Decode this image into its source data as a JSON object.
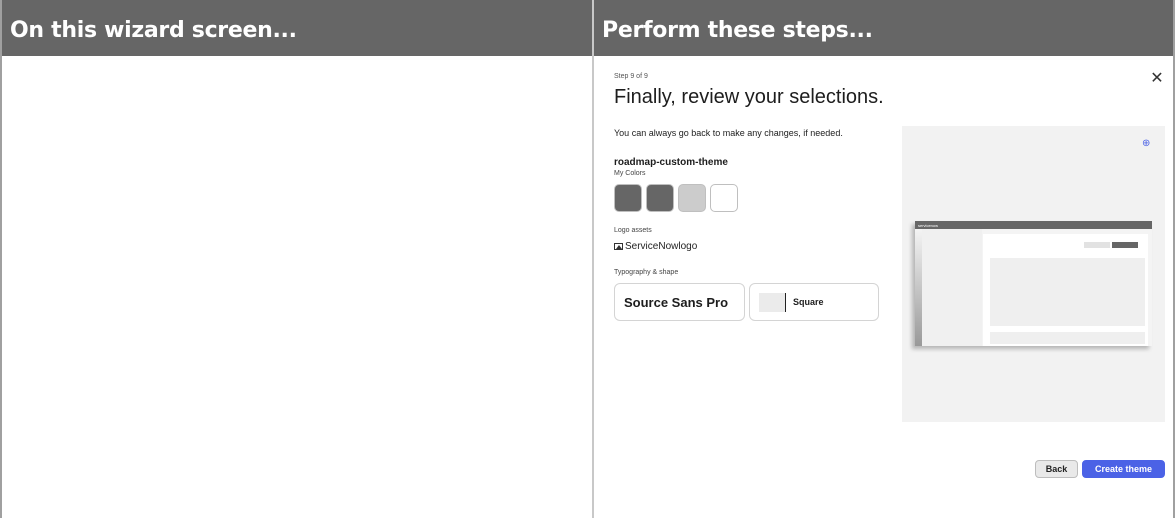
{
  "columns": {
    "left_header": "On this wizard screen...",
    "right_header": "Perform these steps..."
  },
  "wizard": {
    "step": "Step 9 of 9",
    "close_icon": "close-icon",
    "title": "Finally, review your selections.",
    "intro": "You can always go back to make any changes, if needed.",
    "theme_name": "roadmap-custom-theme",
    "colors_label": "My Colors",
    "swatches": [
      "#666666",
      "#666666",
      "#cccccc",
      "#ffffff"
    ],
    "logo_label": "Logo assets",
    "logo_name": "ServiceNowlogo",
    "typography_label": "Typography & shape",
    "font_name": "Source Sans Pro",
    "shape_name": "Square",
    "preview": {
      "zoom_icon": "zoom-in-icon",
      "brand": "servicenow"
    },
    "back_label": "Back",
    "create_label": "Create theme"
  },
  "colors": {
    "header_bg": "#666666",
    "accent": "#4b62e6"
  }
}
